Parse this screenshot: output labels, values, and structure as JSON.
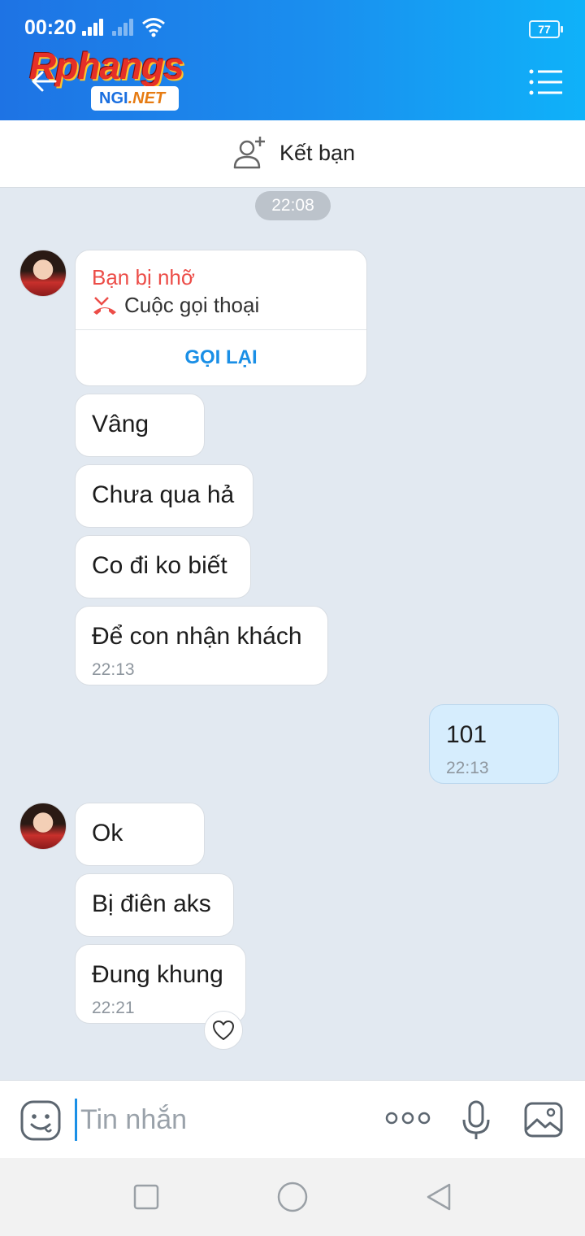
{
  "status_bar": {
    "time": "00:20",
    "battery": "77"
  },
  "header": {
    "logo_main": "Rphangs",
    "logo_sub_left": "NGI",
    "logo_sub_right": ".NET"
  },
  "friend_bar": {
    "label": "Kết bạn"
  },
  "chat": {
    "date_chip": "22:08",
    "missed_call": {
      "title": "Bạn bị nhỡ",
      "subtitle": "Cuộc gọi thoại",
      "action": "GỌI LẠI"
    },
    "messages": [
      {
        "text": "Vâng"
      },
      {
        "text": "Chưa qua hả"
      },
      {
        "text": "Co đi ko biết"
      },
      {
        "text": "Để con nhận khách",
        "time": "22:13"
      },
      {
        "text": "101",
        "time": "22:13"
      },
      {
        "text": "Ok"
      },
      {
        "text": "Bị điên aks"
      },
      {
        "text": "Đung khung",
        "time": "22:21"
      }
    ]
  },
  "input": {
    "placeholder": "Tin nhắn"
  },
  "colors": {
    "header_start": "#1e73e4",
    "header_end": "#0fb2f9",
    "outgoing_bubble": "#d6edfd",
    "missed_red": "#ec4d48",
    "accent_blue": "#1a8fe6"
  },
  "icons": [
    "back-arrow-icon",
    "menu-list-icon",
    "add-friend-icon",
    "missed-call-icon",
    "heart-icon",
    "sticker-icon",
    "more-dots-icon",
    "microphone-icon",
    "image-icon",
    "nav-recent-icon",
    "nav-home-icon",
    "nav-back-icon"
  ]
}
